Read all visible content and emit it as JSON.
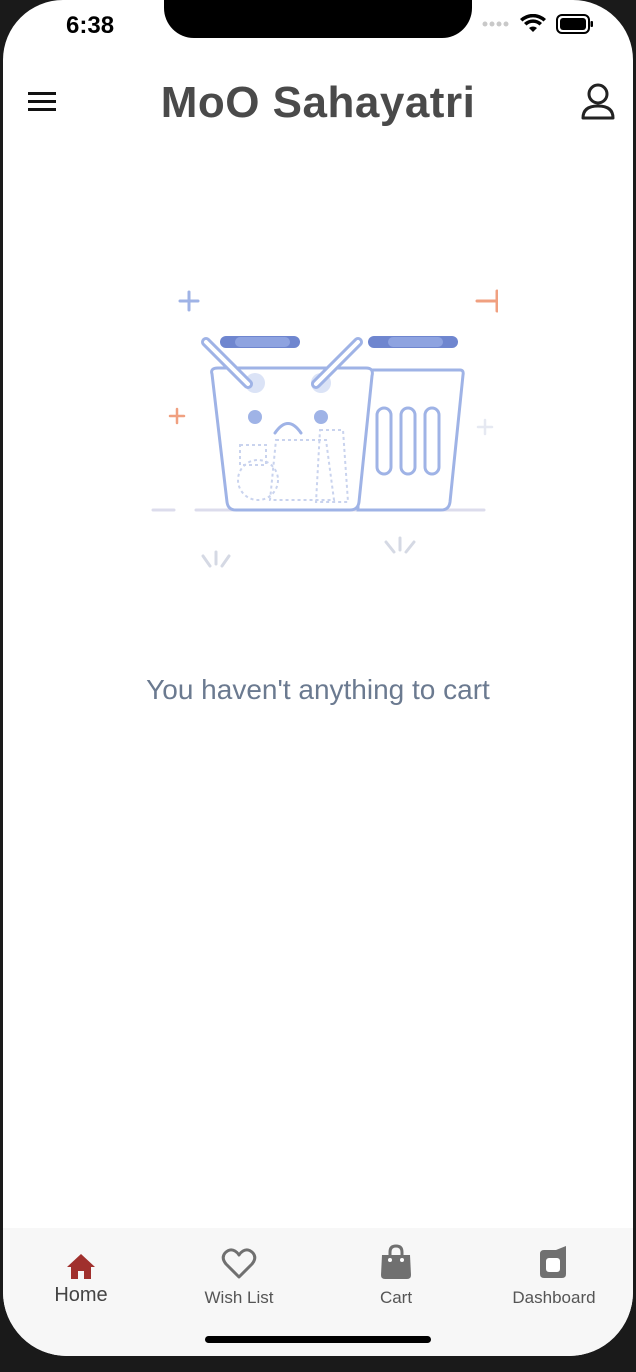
{
  "status_bar": {
    "time": "6:38"
  },
  "header": {
    "title": "MoO Sahayatri",
    "menu_icon": "hamburger-menu-icon",
    "profile_icon": "user-profile-icon"
  },
  "empty_state": {
    "message": "You haven't anything to cart",
    "illustration": "sad-empty-baskets"
  },
  "bottom_nav": {
    "items": [
      {
        "label": "Home",
        "icon": "home-icon",
        "active": true
      },
      {
        "label": "Wish List",
        "icon": "heart-icon",
        "active": false
      },
      {
        "label": "Cart",
        "icon": "shopping-bag-icon",
        "active": false
      },
      {
        "label": "Dashboard",
        "icon": "dashboard-icon",
        "active": false
      }
    ]
  },
  "colors": {
    "active_nav": "#a0302d",
    "inactive_nav": "#707070",
    "title": "#4a4a4a",
    "message": "#6b7a90",
    "illustration_blue": "#9fb3e6",
    "illustration_accent": "#f0a080"
  }
}
